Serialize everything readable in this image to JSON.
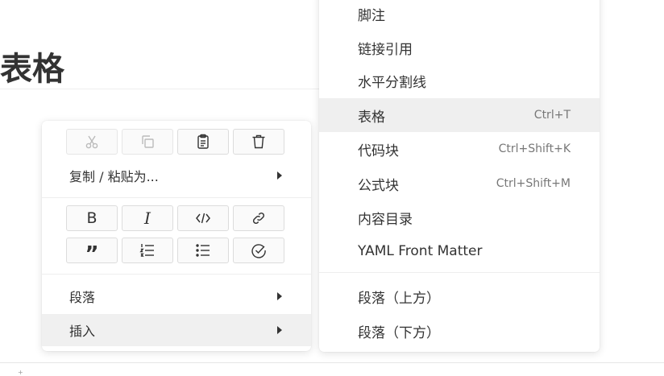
{
  "document": {
    "title": "表格"
  },
  "context_menu": {
    "edit_icons": [
      {
        "name": "cut-icon",
        "disabled": true
      },
      {
        "name": "copy-icon",
        "disabled": true
      },
      {
        "name": "paste-icon",
        "disabled": false
      },
      {
        "name": "delete-icon",
        "disabled": false
      }
    ],
    "copy_paste_as": "复制 / 粘贴为...",
    "format_icons": [
      "bold-icon",
      "italic-icon",
      "code-icon",
      "link-icon",
      "quote-icon",
      "ordered-list-icon",
      "unordered-list-icon",
      "task-list-icon"
    ],
    "paragraph": "段落",
    "insert": "插入"
  },
  "submenu": {
    "items": [
      {
        "label": "脚注",
        "shortcut": ""
      },
      {
        "label": "链接引用",
        "shortcut": ""
      },
      {
        "label": "水平分割线",
        "shortcut": ""
      },
      {
        "label": "表格",
        "shortcut": "Ctrl+T"
      },
      {
        "label": "代码块",
        "shortcut": "Ctrl+Shift+K"
      },
      {
        "label": "公式块",
        "shortcut": "Ctrl+Shift+M"
      },
      {
        "label": "内容目录",
        "shortcut": ""
      },
      {
        "label": "YAML Front Matter",
        "shortcut": ""
      },
      {
        "label": "段落（上方）",
        "shortcut": ""
      },
      {
        "label": "段落（下方）",
        "shortcut": ""
      }
    ],
    "highlighted": "表格"
  }
}
